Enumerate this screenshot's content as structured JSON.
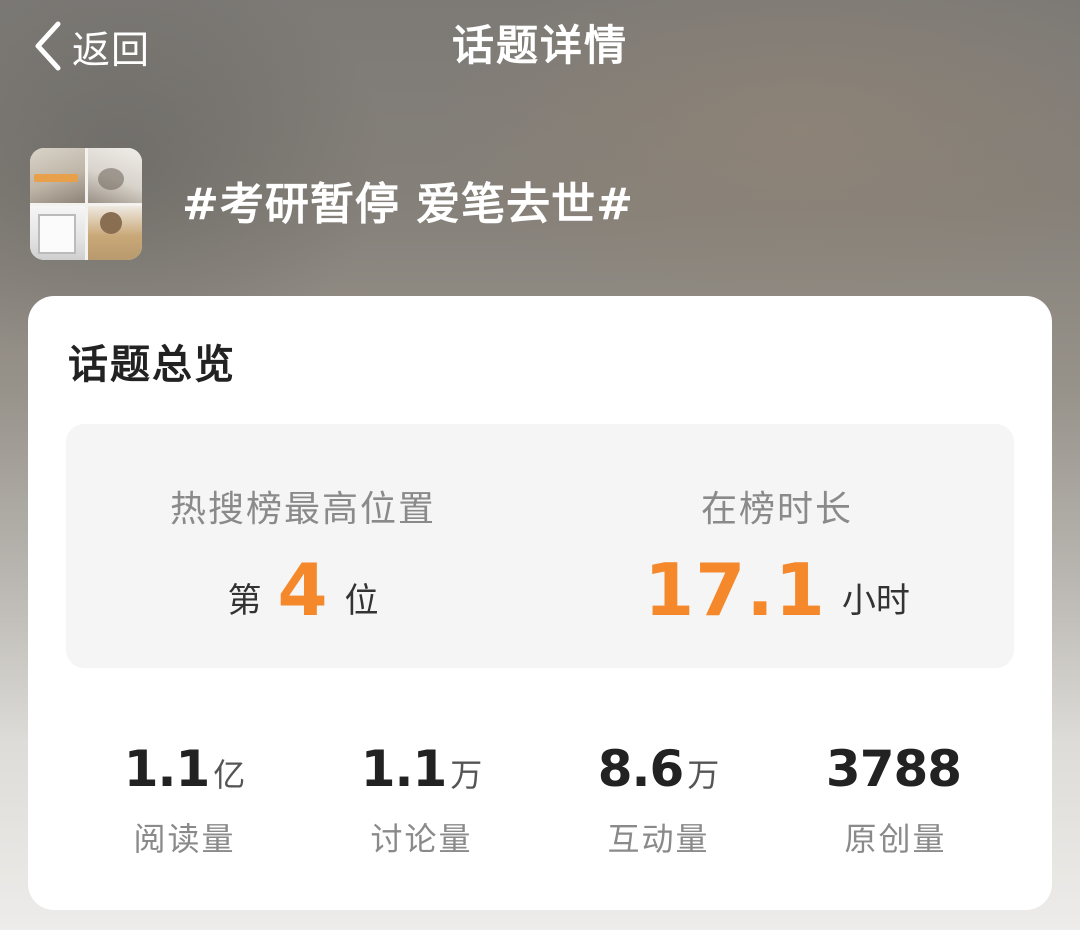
{
  "nav": {
    "back_label": "返回",
    "title": "话题详情"
  },
  "topic": {
    "title": "#考研暂停 爱笔去世#",
    "thumbnail_icon": "topic-collage-image"
  },
  "overview": {
    "title": "话题总览",
    "highest_rank": {
      "label": "热搜榜最高位置",
      "prefix": "第",
      "value": "4",
      "suffix": "位"
    },
    "duration": {
      "label": "在榜时长",
      "value": "17.1",
      "unit": "小时"
    },
    "accent_color": "#f4882a"
  },
  "stats": [
    {
      "value": "1.1",
      "unit": "亿",
      "label": "阅读量"
    },
    {
      "value": "1.1",
      "unit": "万",
      "label": "讨论量"
    },
    {
      "value": "8.6",
      "unit": "万",
      "label": "互动量"
    },
    {
      "value": "3788",
      "unit": "",
      "label": "原创量"
    }
  ]
}
